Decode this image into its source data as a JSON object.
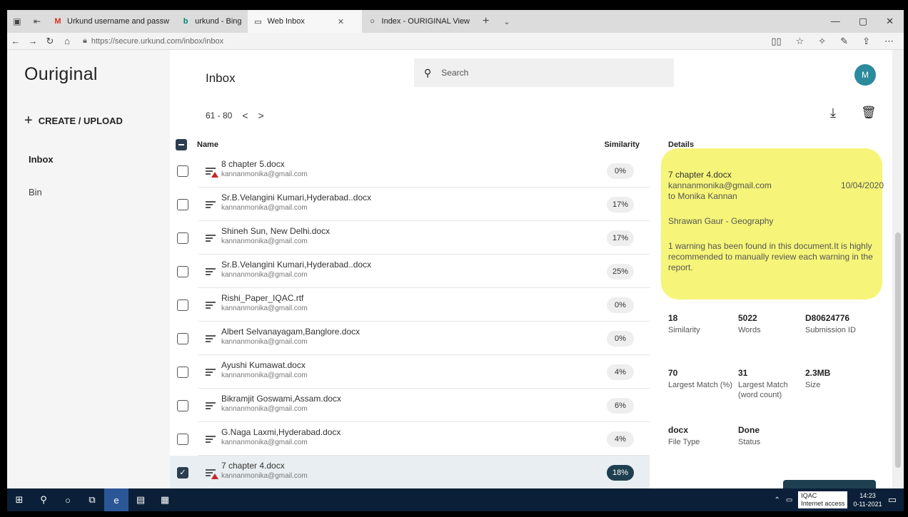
{
  "browser": {
    "tabs": [
      {
        "label": "Urkund username and passw",
        "icon": "gmail-icon",
        "active": false
      },
      {
        "label": "urkund - Bing",
        "icon": "bing-icon",
        "active": false
      },
      {
        "label": "Web Inbox",
        "icon": "page-icon",
        "active": true
      },
      {
        "label": "Index - OURIGINAL View",
        "icon": "circle-icon",
        "active": false
      }
    ],
    "url": "https://secure.urkund.com/inbox/inbox"
  },
  "sidebar": {
    "logo": "Ouriginal",
    "create_label": "CREATE / UPLOAD",
    "items": [
      {
        "label": "Inbox"
      },
      {
        "label": "Bin"
      }
    ]
  },
  "header": {
    "title": "Inbox",
    "search_placeholder": "Search",
    "avatar_initial": "M"
  },
  "pager": {
    "range": "61 - 80"
  },
  "list": {
    "col_name": "Name",
    "col_similarity": "Similarity",
    "rows": [
      {
        "name": "8 chapter 5.docx",
        "email": "kannanmonika@gmail.com",
        "similarity": "0%",
        "warning": true,
        "selected": false
      },
      {
        "name": "Sr.B.Velangini Kumari,Hyderabad..docx",
        "email": "kannanmonika@gmail.com",
        "similarity": "17%",
        "warning": false,
        "selected": false
      },
      {
        "name": "Shineh Sun, New Delhi.docx",
        "email": "kannanmonika@gmail.com",
        "similarity": "17%",
        "warning": false,
        "selected": false
      },
      {
        "name": "Sr.B.Velangini Kumari,Hyderabad..docx",
        "email": "kannanmonika@gmail.com",
        "similarity": "25%",
        "warning": false,
        "selected": false
      },
      {
        "name": "Rishi_Paper_IQAC.rtf",
        "email": "kannanmonika@gmail.com",
        "similarity": "0%",
        "warning": false,
        "selected": false
      },
      {
        "name": "Albert Selvanayagam,Banglore.docx",
        "email": "kannanmonika@gmail.com",
        "similarity": "0%",
        "warning": false,
        "selected": false
      },
      {
        "name": "Ayushi Kumawat.docx",
        "email": "kannanmonika@gmail.com",
        "similarity": "4%",
        "warning": false,
        "selected": false
      },
      {
        "name": "Bikramjit Goswami,Assam.docx",
        "email": "kannanmonika@gmail.com",
        "similarity": "6%",
        "warning": false,
        "selected": false
      },
      {
        "name": "G.Naga Laxmi,Hyderabad.docx",
        "email": "kannanmonika@gmail.com",
        "similarity": "4%",
        "warning": false,
        "selected": false
      },
      {
        "name": "7 chapter 4.docx",
        "email": "kannanmonika@gmail.com",
        "similarity": "18%",
        "warning": true,
        "selected": true
      }
    ]
  },
  "details": {
    "title": "Details",
    "doc_name": "7 chapter 4.docx",
    "email": "kannanmonika@gmail.com",
    "date": "10/04/2020",
    "to": "to Monika Kannan",
    "course": "Shrawan Gaur - Geography",
    "warning_text": "1 warning has been found in this document.It is highly recommended to manually review each warning in the report.",
    "stats": [
      {
        "value": "18",
        "label": "Similarity"
      },
      {
        "value": "5022",
        "label": "Words"
      },
      {
        "value": "D80624776",
        "label": "Submission ID"
      },
      {
        "value": "70",
        "label": "Largest Match (%)"
      },
      {
        "value": "31",
        "label": "Largest Match (word count)"
      },
      {
        "value": "2.3MB",
        "label": "Size"
      },
      {
        "value": "docx",
        "label": "File Type"
      },
      {
        "value": "Done",
        "label": "Status"
      }
    ]
  },
  "taskbar": {
    "tooltip_title": "IQAC",
    "tooltip_sub": "Internet access",
    "time": "14:23",
    "date": "0-11-2021"
  }
}
